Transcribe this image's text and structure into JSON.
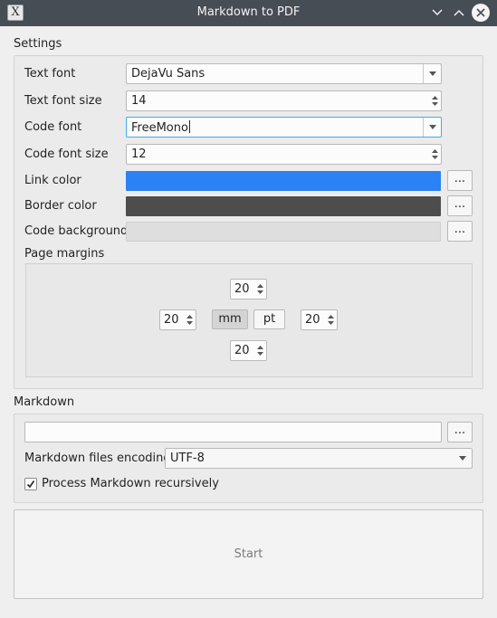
{
  "window": {
    "title": "Markdown to PDF",
    "app_icon_glyph": "X"
  },
  "settings": {
    "group_label": "Settings",
    "text_font": {
      "label": "Text font",
      "value": "DejaVu Sans"
    },
    "text_font_size": {
      "label": "Text font size",
      "value": "14"
    },
    "code_font": {
      "label": "Code font",
      "value": "FreeMono"
    },
    "code_font_size": {
      "label": "Code font size",
      "value": "12"
    },
    "link_color": {
      "label": "Link color",
      "color": "#2a82f3",
      "button": "..."
    },
    "border_color": {
      "label": "Border color",
      "color": "#4d4d4d",
      "button": "..."
    },
    "code_background": {
      "label": "Code background",
      "color": "#dedede",
      "button": "..."
    },
    "page_margins": {
      "label": "Page margins",
      "top": "20",
      "left": "20",
      "right": "20",
      "bottom": "20",
      "unit_mm": "mm",
      "unit_pt": "pt",
      "active_unit": "mm"
    }
  },
  "markdown": {
    "group_label": "Markdown",
    "path_value": "",
    "browse_button": "...",
    "encoding_label": "Markdown files encoding",
    "encoding_value": "UTF-8",
    "recursive_label": "Process Markdown recursively",
    "recursive_checked": true
  },
  "start_button": "Start",
  "colors": {
    "titlebar": "#474d54",
    "window_bg": "#efefef",
    "focus_border": "#3daee9"
  }
}
